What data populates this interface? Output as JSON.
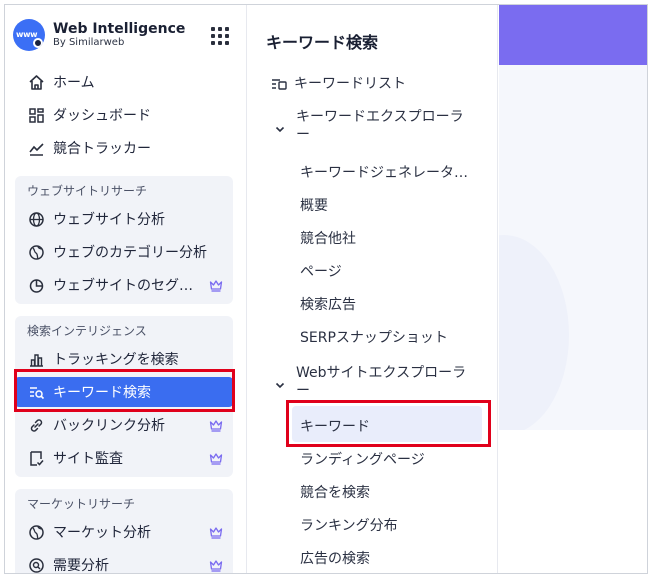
{
  "brand": {
    "title": "Web Intelligence",
    "subtitle": "By Similarweb",
    "logo_text": "www"
  },
  "sidebar": {
    "top_items": [
      {
        "label": "ホーム",
        "icon": "home-icon"
      },
      {
        "label": "ダッシュボード",
        "icon": "dashboard-icon"
      },
      {
        "label": "競合トラッカー",
        "icon": "tracker-icon"
      }
    ],
    "sections": [
      {
        "title": "ウェブサイトリサーチ",
        "items": [
          {
            "label": "ウェブサイト分析",
            "icon": "globe-icon",
            "premium": false
          },
          {
            "label": "ウェブのカテゴリー分析",
            "icon": "category-globe-icon",
            "premium": false
          },
          {
            "label": "ウェブサイトのセグ…",
            "icon": "pie-chart-icon",
            "premium": true
          }
        ]
      },
      {
        "title": "検索インテリジェンス",
        "items": [
          {
            "label": "トラッキングを検索",
            "icon": "bar-chart-icon",
            "premium": false
          },
          {
            "label": "キーワード検索",
            "icon": "keyword-search-icon",
            "premium": false,
            "active": true
          },
          {
            "label": "バックリンク分析",
            "icon": "link-icon",
            "premium": true
          },
          {
            "label": "サイト監査",
            "icon": "audit-icon",
            "premium": true
          }
        ]
      },
      {
        "title": "マーケットリサーチ",
        "items": [
          {
            "label": "マーケット分析",
            "icon": "market-globe-icon",
            "premium": true
          },
          {
            "label": "需要分析",
            "icon": "demand-icon",
            "premium": true
          }
        ]
      }
    ]
  },
  "panel": {
    "title": "キーワード検索",
    "keyword_list": "キーワードリスト",
    "keyword_explorer": {
      "label": "キーワードエクスプローラー",
      "items": [
        "キーワードジェネレータ…",
        "概要",
        "競合他社",
        "ページ",
        "検索広告",
        "SERPスナップショット"
      ]
    },
    "website_explorer": {
      "label": "Webサイトエクスプローラー",
      "items": [
        "キーワード",
        "ランディングページ",
        "競合を検索",
        "ランキング分布",
        "広告の検索"
      ],
      "selected": "キーワード"
    }
  },
  "colors": {
    "accent": "#3a6df0",
    "highlight_border": "#e0001b",
    "section_bg": "#f1f3f8",
    "right_banner": "#7a6cf0"
  }
}
